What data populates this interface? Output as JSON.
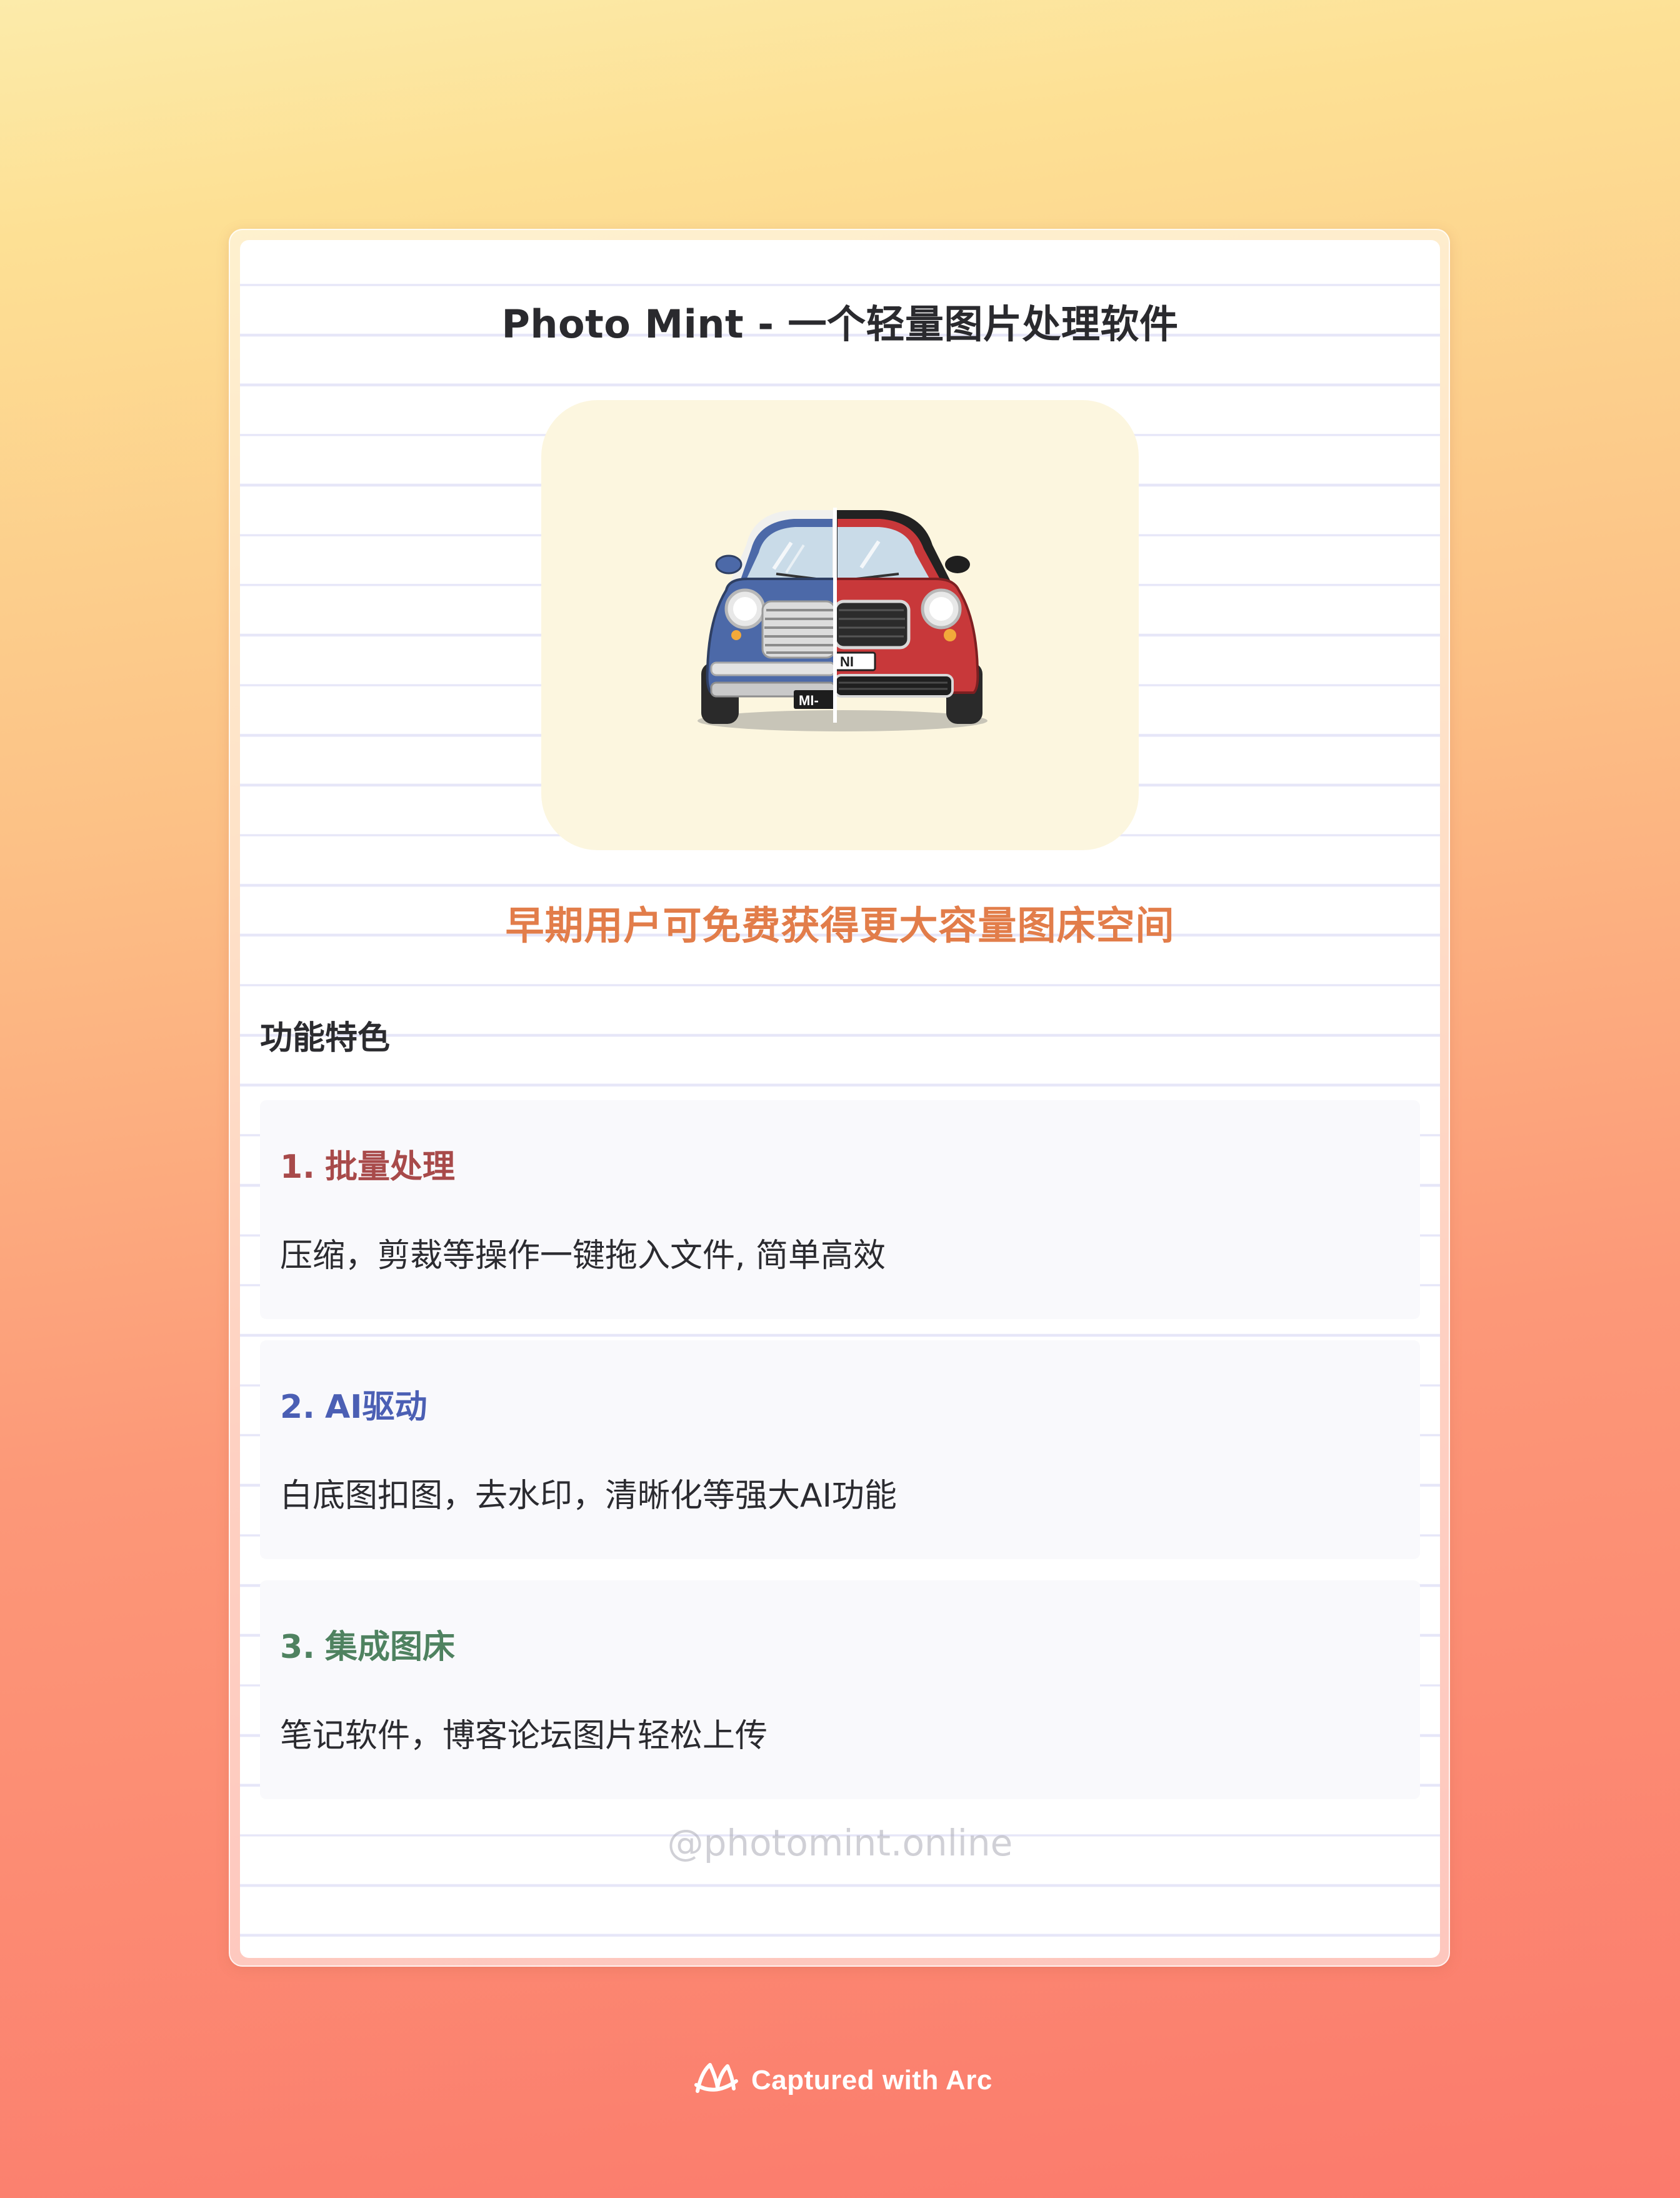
{
  "page": {
    "title": "Photo Mint - 一个轻量图片处理软件",
    "promo": "早期用户可免费获得更大容量图床空间",
    "hero_image": {
      "plate_left": "MI-",
      "plate_right": "NI"
    },
    "features_heading": "功能特色",
    "features": [
      {
        "number": "1.",
        "title": "批量处理",
        "description": "压缩，剪裁等操作一键拖入文件, 简单高效"
      },
      {
        "number": "2.",
        "title": "AI驱动",
        "description": "白底图扣图，去水印，清晰化等强大AI功能"
      },
      {
        "number": "3.",
        "title": "集成图床",
        "description": "笔记软件，博客论坛图片轻松上传"
      }
    ],
    "watermark": "@photomint.online"
  },
  "footer": {
    "label": "Captured with Arc",
    "icon": "arc-logo-icon"
  },
  "colors": {
    "promo": "#e27d4a",
    "feature_1": "#a84a4a",
    "feature_2": "#4b5fb4",
    "feature_3": "#4f8260",
    "car_left": "#4c69a8",
    "car_right": "#c8383a",
    "hero_background": "#fcf6df"
  }
}
